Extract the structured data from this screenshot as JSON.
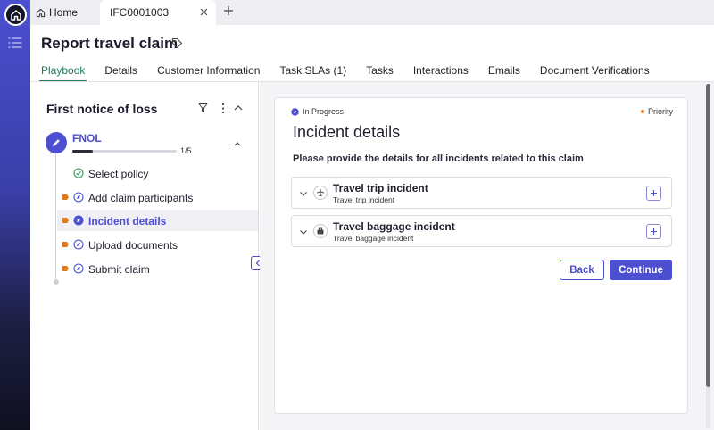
{
  "app": {
    "tabs": [
      {
        "label": "Home",
        "icon": "home-icon"
      },
      {
        "label": "IFC0001003",
        "active": true
      }
    ]
  },
  "header": {
    "title": "Report travel claim",
    "nav_tabs": [
      {
        "label": "Playbook",
        "active": true
      },
      {
        "label": "Details"
      },
      {
        "label": "Customer Information"
      },
      {
        "label": "Task SLAs (1)"
      },
      {
        "label": "Tasks"
      },
      {
        "label": "Interactions"
      },
      {
        "label": "Emails"
      },
      {
        "label": "Document Verifications"
      }
    ]
  },
  "playbook": {
    "title": "First notice of loss",
    "stage": {
      "name": "FNOL",
      "progress_text": "1/5",
      "progress": 0.2
    },
    "steps": [
      {
        "label": "Select policy",
        "state": "complete"
      },
      {
        "label": "Add claim participants",
        "state": "pending"
      },
      {
        "label": "Incident details",
        "state": "current"
      },
      {
        "label": "Upload documents",
        "state": "pending"
      },
      {
        "label": "Submit claim",
        "state": "pending"
      }
    ]
  },
  "card": {
    "status": "In Progress",
    "priority": "Priority",
    "title": "Incident details",
    "instruction": "Please provide the details for all incidents related to this claim",
    "incidents": [
      {
        "title": "Travel trip incident",
        "subtitle": "Travel trip incident",
        "icon": "plane-icon"
      },
      {
        "title": "Travel baggage incident",
        "subtitle": "Travel baggage incident",
        "icon": "baggage-icon"
      }
    ],
    "back_label": "Back",
    "continue_label": "Continue"
  },
  "colors": {
    "accent": "#4b4fd0",
    "active_tab": "#1c7d5f",
    "flag": "#e07a1e",
    "complete": "#2e9b57"
  }
}
